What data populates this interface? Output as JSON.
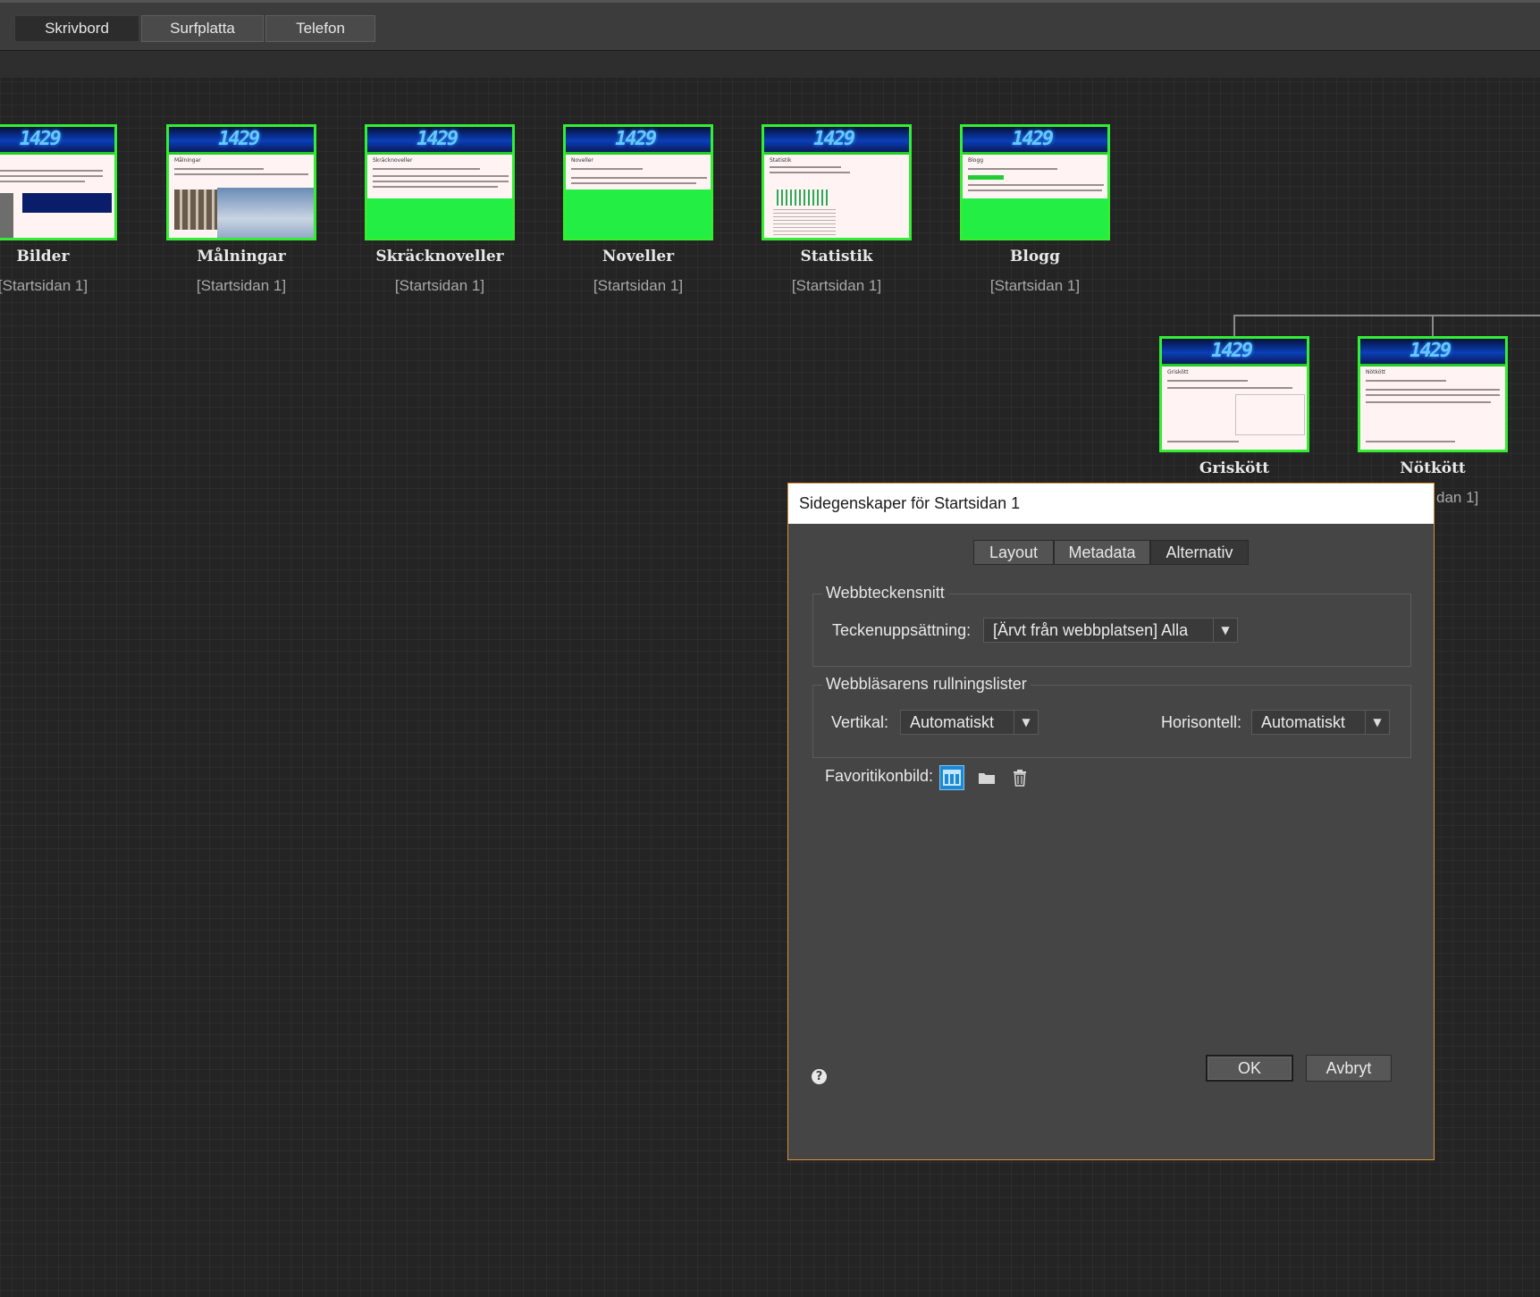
{
  "device_tabs": [
    "Skrivbord",
    "Surfplatta",
    "Telefon"
  ],
  "pages": [
    {
      "title": "Bilder",
      "sub": "[Startsidan 1]"
    },
    {
      "title": "Målningar",
      "sub": "[Startsidan 1]"
    },
    {
      "title": "Skräcknoveller",
      "sub": "[Startsidan 1]"
    },
    {
      "title": "Noveller",
      "sub": "[Startsidan 1]"
    },
    {
      "title": "Statistik",
      "sub": "[Startsidan 1]"
    },
    {
      "title": "Blogg",
      "sub": "[Startsidan 1]"
    },
    {
      "title": "Griskött",
      "sub": ""
    },
    {
      "title": "Nötkött",
      "sub": "dan 1]"
    }
  ],
  "thumb_banner_text": "1429",
  "thumb_captions": {
    "bilder": "",
    "malningar": "Målningar",
    "skracknoveller": "Skräcknoveller",
    "noveller": "Noveller",
    "statistik": "Statistik",
    "blogg": "Blogg",
    "griskott": "Griskött",
    "notkott": "Nötkött"
  },
  "dialog": {
    "title": "Sidegenskaper för Startsidan 1",
    "tabs": [
      "Layout",
      "Metadata",
      "Alternativ"
    ],
    "active_tab": "Alternativ",
    "webfonts_legend": "Webbteckensnitt",
    "charset_label": "Teckenuppsättning:",
    "charset_value": "[Ärvt från webbplatsen] Alla",
    "scrollbars_legend": "Webbläsarens rullningslister",
    "vertical_label": "Vertikal:",
    "vertical_value": "Automatiskt",
    "horizontal_label": "Horisontell:",
    "horizontal_value": "Automatiskt",
    "favicon_label": "Favoritikonbild:",
    "help_symbol": "?",
    "ok_label": "OK",
    "cancel_label": "Avbryt"
  },
  "colors": {
    "thumb_border": "#33ee33",
    "dialog_border": "#d9903a",
    "favicon_blue": "#1e88d0"
  }
}
